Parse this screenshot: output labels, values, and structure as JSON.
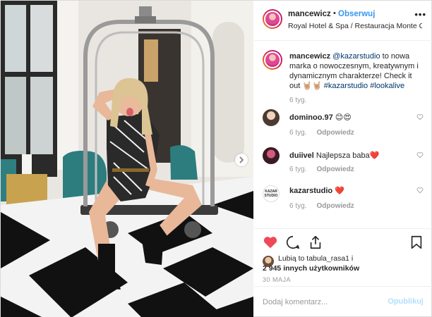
{
  "header": {
    "username": "mancewicz",
    "dot": "•",
    "follow": "Obserwuj",
    "location": "Royal Hotel & Spa / Restauracja Monte C..."
  },
  "caption": {
    "username": "mancewicz",
    "mention": "@kazarstudio",
    "text": " to nowa marka o nowoczesnym, kreatywnym i dynamicznym charakterze! Check it out 🤘🏼🤘🏼 ",
    "tag1": "#kazarstudio",
    "tag2": "#lookalive",
    "time": "6 tyg."
  },
  "comments": [
    {
      "username": "dominoo.97",
      "text": " 😊😍",
      "time": "6 tyg.",
      "reply": "Odpowiedz"
    },
    {
      "username": "duiivel",
      "text": " Najlepsza baba❤️",
      "time": "6 tyg.",
      "reply": "Odpowiedz"
    },
    {
      "username": "kazarstudio",
      "text": " ❤️",
      "time": "6 tyg.",
      "reply": "Odpowiedz",
      "avatar_text": "KAZAR STUDIO"
    }
  ],
  "likes": {
    "line1": "Lubią to tabula_rasa1 i",
    "line2": "2 945 innych użytkowników"
  },
  "date": "30 MAJA",
  "add_comment": {
    "placeholder": "Dodaj komentarz...",
    "publish": "Opublikuj"
  },
  "colors": {
    "accent": "#3897f0",
    "like_red": "#ed4956",
    "publish_disabled": "#b2dffc"
  },
  "icons": [
    "heart-icon",
    "comment-icon",
    "share-icon",
    "bookmark-icon",
    "more-options-icon",
    "chevron-right-icon"
  ]
}
